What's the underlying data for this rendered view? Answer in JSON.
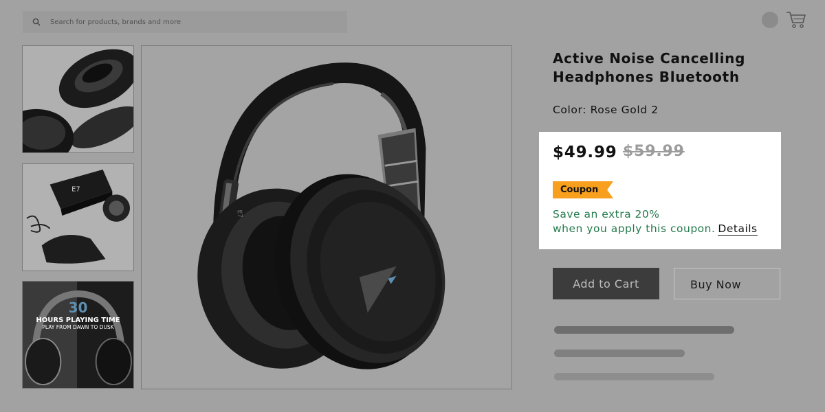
{
  "search": {
    "placeholder": "Search for products, brands and more",
    "icon": "search-icon"
  },
  "header": {
    "avatar_icon": "user-avatar",
    "cart_icon": "cart-icon"
  },
  "thumbnails": [
    {
      "name": "ear-cushions"
    },
    {
      "name": "package-contents",
      "box_label": "E7"
    },
    {
      "name": "battery-feature",
      "overlay_number": "30",
      "overlay_line1": "HOURS PLAYING TIME",
      "overlay_line2": "PLAY FROM DAWN TO DUSK"
    }
  ],
  "main_image": {
    "name": "headphones-main-photo",
    "earcup_label": "E7"
  },
  "product": {
    "title_line1": "Active Noise Cancelling",
    "title_line2": "Headphones Bluetooth",
    "color_label": "Color:",
    "color_value": "Rose Gold 2"
  },
  "pricing": {
    "price": "$49.99",
    "old_price": "$59.99",
    "coupon_label": "Coupon",
    "save_line1": "Save an extra 20%",
    "save_line2": "when you apply this coupon.",
    "details_link": "Details"
  },
  "actions": {
    "add_to_cart": "Add to Cart",
    "buy_now": "Buy Now"
  },
  "colors": {
    "background": "#a2a2a2",
    "coupon_tag": "#f8a01d",
    "coupon_text": "#237a4b",
    "add_button": "#3c3c3c",
    "price_box": "#ffffff"
  }
}
